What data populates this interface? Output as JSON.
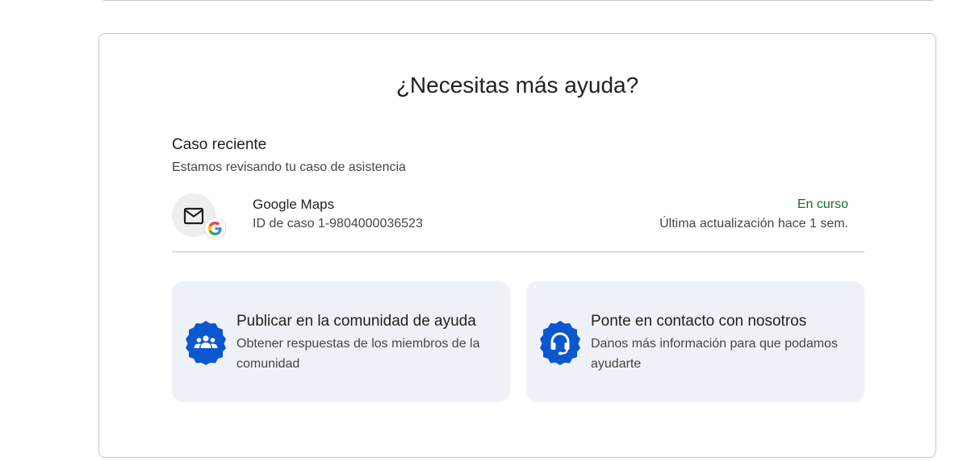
{
  "help_panel": {
    "title": "¿Necesitas más ayuda?"
  },
  "recent_case": {
    "heading": "Caso reciente",
    "subtitle": "Estamos revisando tu caso de asistencia",
    "product": "Google Maps",
    "case_id": "ID de caso 1-9804000036523",
    "status": "En curso",
    "status_color": "#146c2e",
    "last_updated": "Última actualización hace 1 sem.",
    "icon": "mail-icon",
    "badge_icon": "google-logo-icon"
  },
  "options": {
    "community": {
      "title": "Publicar en la comunidad de ayuda",
      "description": "Obtener respuestas de los miembros de la comunidad",
      "icon": "community-group-icon"
    },
    "contact": {
      "title": "Ponte en contacto con nosotros",
      "description": "Danos más información para que podamos ayudarte",
      "icon": "headset-icon"
    }
  },
  "colors": {
    "accent": "#0b57d0",
    "card_bg": "#eef2f8",
    "border": "#c4c7c5"
  }
}
